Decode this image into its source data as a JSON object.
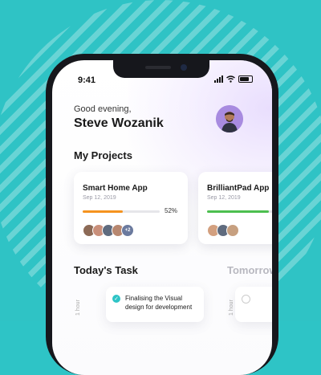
{
  "status_bar": {
    "time": "9:41"
  },
  "header": {
    "greeting": "Good evening,",
    "user_name": "Steve Wozanik"
  },
  "sections": {
    "projects_title": "My Projects",
    "today_title": "Today's Task",
    "tomorrow_title": "Tomorrow"
  },
  "projects": [
    {
      "title": "Smart Home App",
      "date": "Sep 12, 2019",
      "progress": 0.52,
      "progress_label": "52%",
      "bar_color": "#f5931f",
      "extra_members": "+2"
    },
    {
      "title": "BrilliantPad App",
      "date": "Sep 12, 2019",
      "progress": 0.8,
      "progress_label": "",
      "bar_color": "#4cbf4f",
      "extra_members": ""
    }
  ],
  "tasks": {
    "hour_label": "1 hour",
    "items": [
      {
        "text": "Finalising the Visual design for development",
        "done": true
      }
    ]
  },
  "colors": {
    "background": "#2fc3c5",
    "accent": "#2ec4c6"
  }
}
